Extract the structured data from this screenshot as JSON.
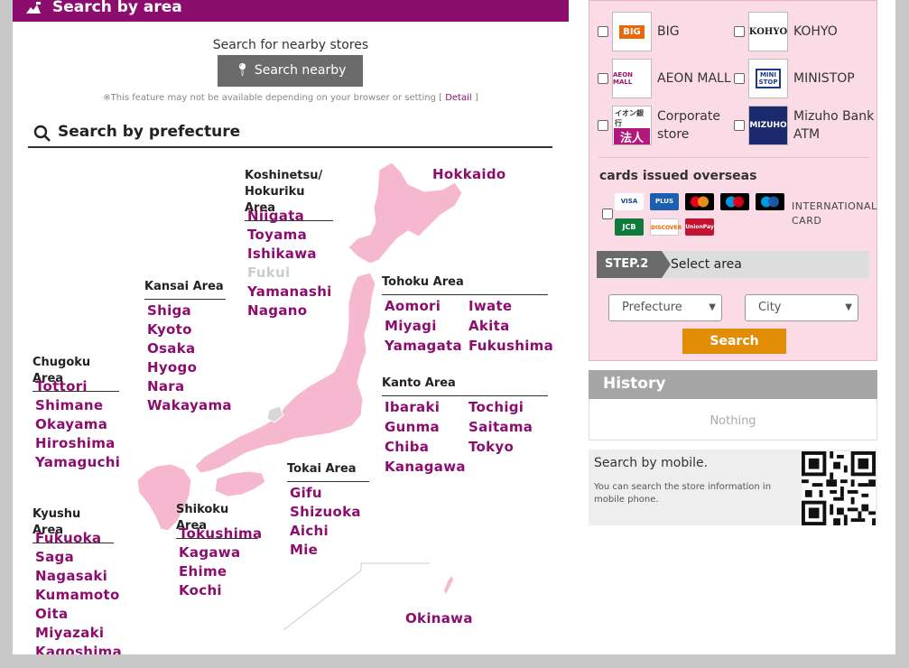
{
  "left": {
    "header_title": "Search by area",
    "nearby": {
      "title": "Search for nearby stores",
      "button": "Search nearby",
      "note": "※This feature may not be available depending on your browser or setting",
      "note_open": "[",
      "detail": "Detail",
      "note_close": "]"
    },
    "pref_title": "Search by prefecture",
    "areas": {
      "hokkaido": "Hokkaido",
      "koshinetsu": {
        "title1": "Koshinetsu/",
        "title2": "Hokuriku Area",
        "items": [
          "Niigata",
          "Toyama",
          "Ishikawa",
          "Fukui",
          "Yamanashi",
          "Nagano"
        ]
      },
      "tohoku": {
        "title": "Tohoku Area",
        "items": [
          "Aomori",
          "Iwate",
          "Miyagi",
          "Akita",
          "Yamagata",
          "Fukushima"
        ]
      },
      "kanto": {
        "title": "Kanto Area",
        "items": [
          "Ibaraki",
          "Tochigi",
          "Gunma",
          "Saitama",
          "Chiba",
          "Tokyo",
          "Kanagawa"
        ]
      },
      "kansai": {
        "title": "Kansai Area",
        "items": [
          "Shiga",
          "Kyoto",
          "Osaka",
          "Hyogo",
          "Nara",
          "Wakayama"
        ]
      },
      "chugoku": {
        "title": "Chugoku Area",
        "items": [
          "Tottori",
          "Shimane",
          "Okayama",
          "Hiroshima",
          "Yamaguchi"
        ]
      },
      "kyushu": {
        "title": "Kyushu Area",
        "items": [
          "Fukuoka",
          "Saga",
          "Nagasaki",
          "Kumamoto",
          "Oita",
          "Miyazaki",
          "Kagoshima"
        ]
      },
      "shikoku": {
        "title": "Shikoku Area",
        "items": [
          "Tokushima",
          "Kagawa",
          "Ehime",
          "Kochi"
        ]
      },
      "tokai": {
        "title": "Tokai Area",
        "items": [
          "Gifu",
          "Shizuoka",
          "Aichi",
          "Mie"
        ]
      },
      "okinawa": "Okinawa"
    }
  },
  "right": {
    "brands": {
      "big": "BIG",
      "big_logo": "BIG",
      "kohyo": "KOHYO",
      "kohyo_logo": "KOHYO",
      "aeonmall": "AEON MALL",
      "aeonmall_logo": "AEON MALL",
      "ministop": "MINISTOP",
      "ministop_logo": "MINI STOP",
      "corporate1": "Corporate",
      "corporate2": "store",
      "corporate_logo_top": "イオン銀行",
      "corporate_logo_bottom": "法人",
      "mizuho1": "Mizuho Bank",
      "mizuho2": "ATM",
      "mizuho_logo": "MIZUHO"
    },
    "overseas": "cards issued overseas",
    "intl1": "INTERNATIONAL",
    "intl2": "CARD",
    "cards": [
      "VISA",
      "PLUS",
      "",
      "",
      "",
      "JCB",
      "DISCOVER",
      "UnionPay"
    ],
    "step_badge": "STEP.2",
    "step_label": "Select area",
    "prefecture": "Prefecture",
    "city": "City",
    "search": "Search",
    "history_title": "History",
    "history_empty": "Nothing",
    "mobile_title": "Search by mobile.",
    "mobile_desc": "You can search the store information in mobile phone."
  },
  "colors": {
    "accent": "#8b0e6e",
    "map_fill": "#f5b8cf",
    "search_btn": "#e28d06"
  }
}
